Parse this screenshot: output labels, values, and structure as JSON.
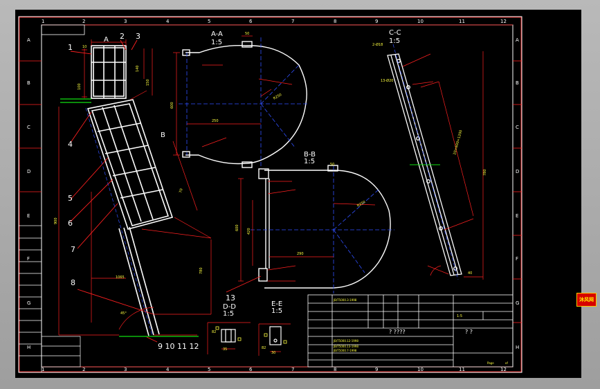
{
  "colors": {
    "frame": "#ffffff",
    "dim": "#ff2020",
    "center": "#3050ff",
    "part": "#ffffff",
    "ref": "#ffff40",
    "green": "#10e010",
    "bg": "#000000"
  },
  "columns": [
    "1",
    "2",
    "3",
    "4",
    "5",
    "6",
    "7",
    "8",
    "9",
    "10",
    "11",
    "12"
  ],
  "rows": [
    "A",
    "B",
    "C",
    "D",
    "E",
    "F",
    "G",
    "H"
  ],
  "views": {
    "a": {
      "name": "A-A",
      "scale": "1:5"
    },
    "b": {
      "name": "B-B",
      "scale": "1:5"
    },
    "c": {
      "name": "C-C",
      "scale": "1:5"
    },
    "d": {
      "name": "D-D",
      "scale": "1:5"
    },
    "e": {
      "name": "E-E",
      "scale": "1:5"
    }
  },
  "balloons": {
    "b1": "1",
    "b2": "2",
    "b3": "3",
    "b4": "4",
    "b5": "5",
    "b6": "6",
    "b7": "7",
    "b8": "8",
    "b13": "13",
    "b9_12": "9 10 11 12",
    "vA": "A",
    "vB": "B"
  },
  "dims": {
    "d10": "10",
    "d50": "50",
    "d140": "140",
    "d150": "150",
    "d100": "100",
    "d600": "600",
    "d250": "250",
    "d290": "290",
    "d780": "780",
    "d1065": "1065",
    "d440": "440",
    "d420": "420",
    "d45": "45°",
    "d35": "35",
    "d82": "82",
    "d30": "30",
    "d70": "70",
    "dR250": "R250",
    "d900": "900",
    "d4": "4",
    "d15": "15",
    "d20": "20",
    "d2": "2-Ø18",
    "d13": "13-Ø20",
    "d20600": "20×600=1200",
    "d40": "40"
  },
  "titleblock": {
    "std1": "JB/T5000.3-1998",
    "std2": "JB/T5000.12-1998",
    "std3": "JB/T5000.13-1998",
    "std4": "JB/T5000.7-1998",
    "scale": "1:5",
    "sheet": "1",
    "name": "? ????",
    "code": "? ?",
    "page": "Page",
    "of": "of"
  },
  "badge": "沐风网"
}
